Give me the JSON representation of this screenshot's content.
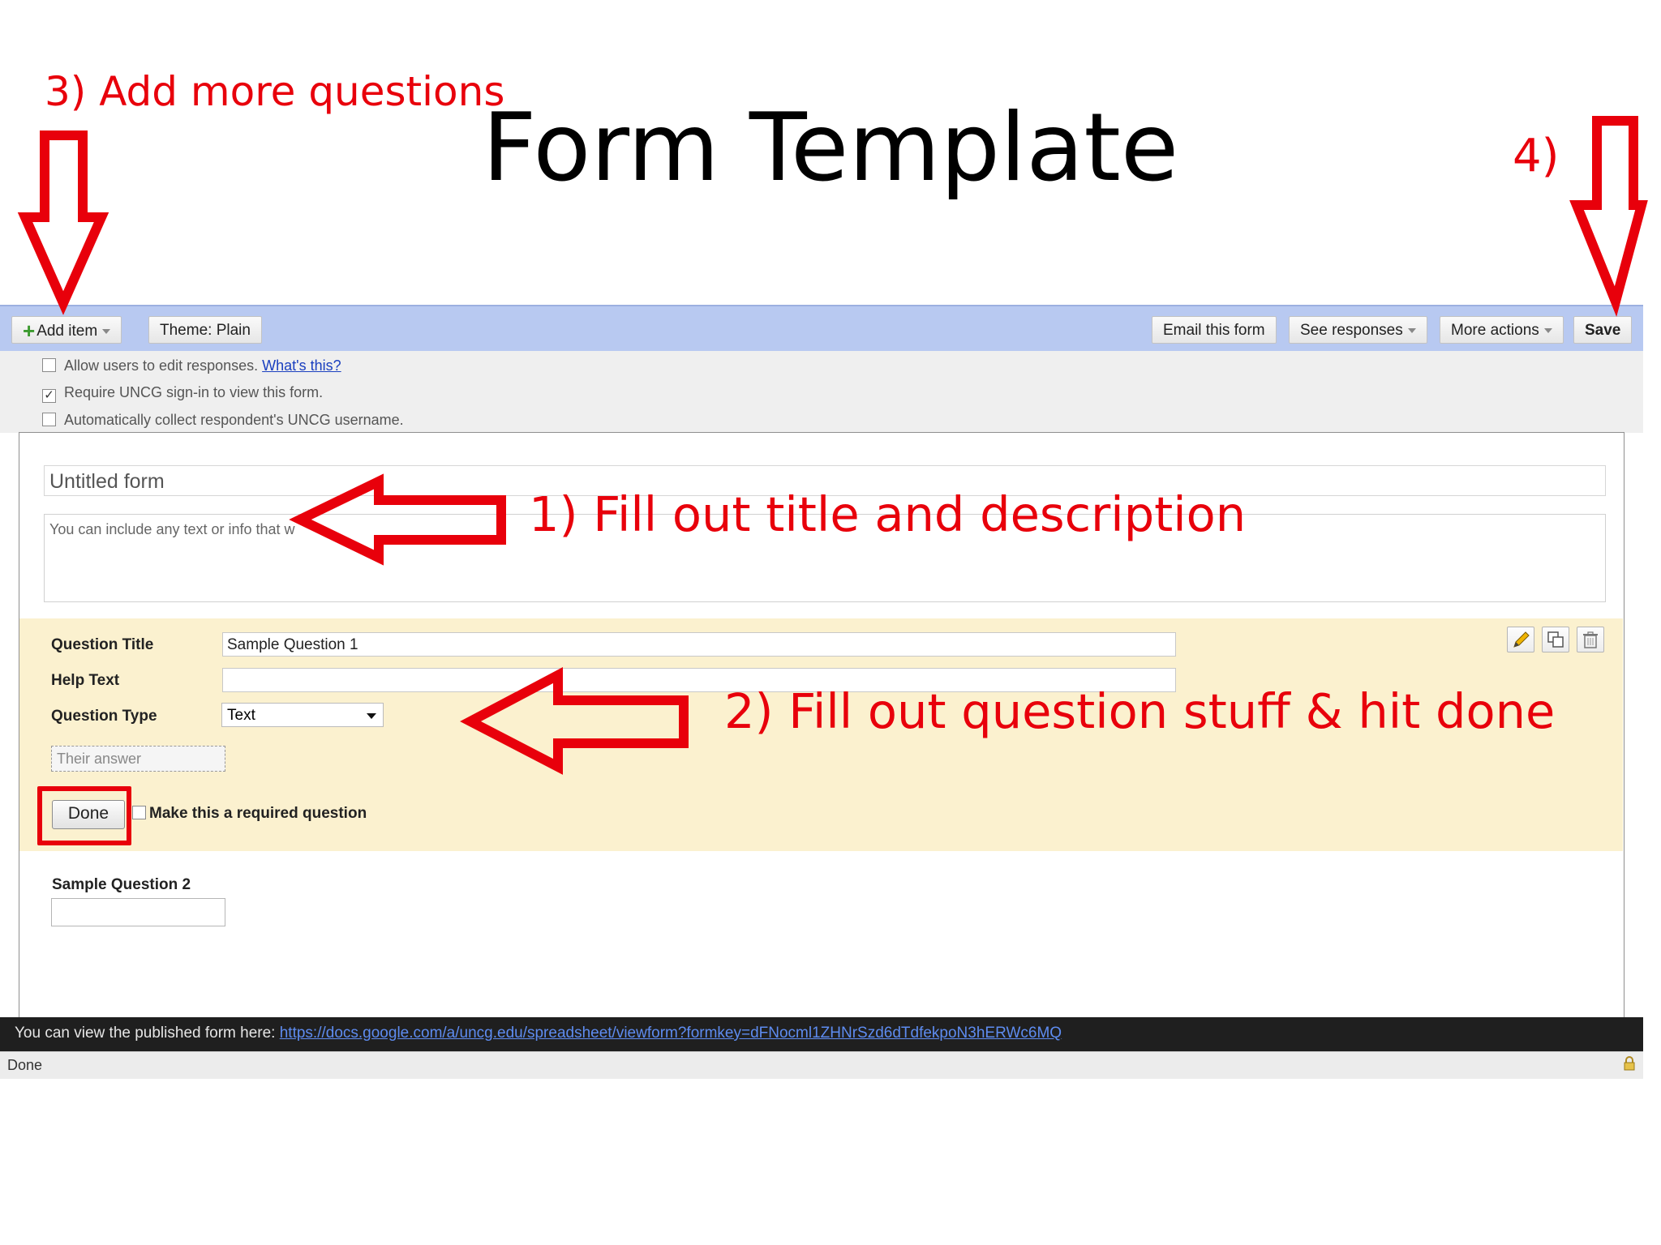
{
  "slide": {
    "title": "Form Template",
    "annotations": {
      "step3": "3) Add more questions",
      "step4": "4)",
      "step1": "1) Fill out title and description",
      "step2": "2) Fill out question stuff & hit done"
    }
  },
  "toolbar": {
    "add_item": "Add item",
    "theme": "Theme:  Plain",
    "email": "Email this form",
    "responses": "See responses",
    "more_actions": "More actions",
    "save": "Save"
  },
  "settings": {
    "allow_edit": {
      "label": "Allow users to edit responses.",
      "link": "What's this?",
      "checked": false
    },
    "require_signin": {
      "label": "Require UNCG sign-in to view this form.",
      "checked": true
    },
    "collect_username": {
      "label": "Automatically collect respondent's UNCG username.",
      "checked": false
    }
  },
  "form": {
    "title": "Untitled form",
    "description": "You can include any text or info that w"
  },
  "question1": {
    "title_label": "Question Title",
    "title_value": "Sample Question 1",
    "help_label": "Help Text",
    "help_value": "",
    "type_label": "Question Type",
    "type_value": "Text",
    "answer_placeholder": "Their answer",
    "done_label": "Done",
    "required_label": "Make this a required question",
    "icons": [
      "pencil-icon",
      "duplicate-icon",
      "trash-icon"
    ]
  },
  "question2": {
    "title": "Sample Question 2"
  },
  "status": {
    "published_text": "You can view the published form here:",
    "published_link": "https://docs.google.com/a/uncg.edu/spreadsheet/viewform?formkey=dFNocml1ZHNrSzd6dTdfekpoN3hERWc6MQ",
    "browser_status": "Done"
  },
  "colors": {
    "annotation": "#e8000b",
    "toolbar": "#b8c9f1",
    "question_bg": "#fbf1cf"
  }
}
